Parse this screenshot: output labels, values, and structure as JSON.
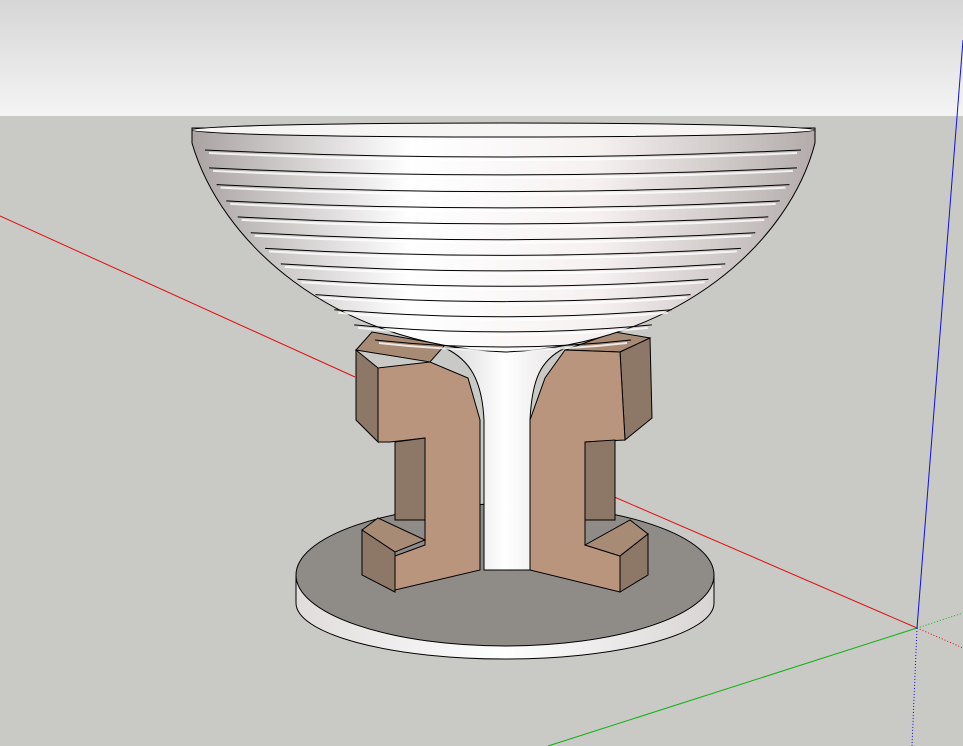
{
  "viewport": {
    "sky_top_color": "#d6d6d6",
    "sky_bottom_color": "#f4f4f4",
    "ground_color": "#c9c9c5"
  },
  "axes": {
    "red_axis_color": "#e01010",
    "green_axis_color": "#10b010",
    "blue_axis_color": "#1010e0"
  },
  "model": {
    "bowl_ring_count": 13,
    "bowl_color": "#f2eeee",
    "bowl_shadow_color": "#b8b0ae",
    "stem_color": "#ffffff",
    "leg_front_color": "#b9957d",
    "leg_side_color": "#8d7766",
    "base_top_color": "#8f8c88",
    "base_side_color": "#f8f6f6",
    "edge_color": "#000000"
  }
}
